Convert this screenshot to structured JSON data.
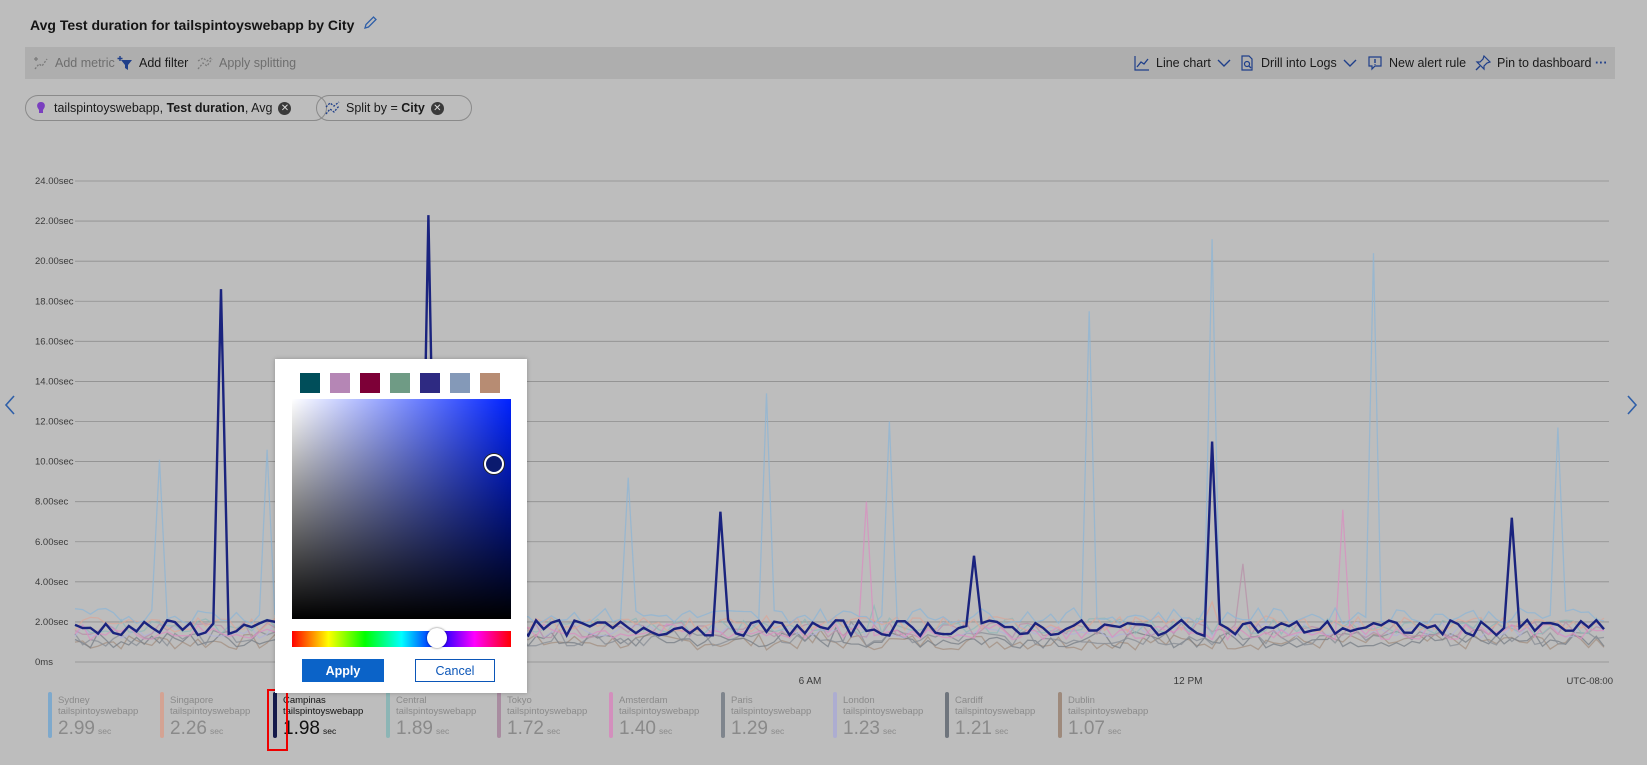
{
  "title": "Avg Test duration for tailspintoyswebapp by City",
  "toolbar": {
    "add_metric": "Add metric",
    "add_filter": "Add filter",
    "apply_splitting": "Apply splitting",
    "line_chart": "Line chart",
    "drill_into_logs": "Drill into Logs",
    "new_alert_rule": "New alert rule",
    "pin_to_dashboard": "Pin to dashboard",
    "more": "···"
  },
  "pills": {
    "metric_prefix": "tailspintoyswebapp, ",
    "metric_bold": "Test duration",
    "metric_suffix": ", Avg",
    "split_prefix": "Split by = ",
    "split_bold": "City"
  },
  "chart_data": {
    "type": "line",
    "y_ticks": [
      "0ms",
      "2.00sec",
      "4.00sec",
      "6.00sec",
      "8.00sec",
      "10.00sec",
      "12.00sec",
      "14.00sec",
      "16.00sec",
      "18.00sec",
      "20.00sec",
      "22.00sec",
      "24.00sec"
    ],
    "ylim": [
      0,
      24
    ],
    "y_unit": "sec",
    "x_ticks": [
      "6 AM",
      "12 PM"
    ],
    "timezone": "UTC-08:00",
    "grid": true,
    "highlighted_series": "Campinas",
    "series": [
      {
        "name": "Sydney",
        "color": "#8db5d6",
        "peaks": [
          10.1,
          10.6,
          7.2,
          9.2,
          13.4,
          12.0,
          17.5,
          21.1,
          20.4,
          11.7
        ]
      },
      {
        "name": "Singapore",
        "color": "#d9a79a",
        "peaks": [
          4.6,
          3.0
        ]
      },
      {
        "name": "Campinas",
        "color": "#1a237e",
        "peaks": [
          18.6,
          22.3,
          7.5,
          5.3,
          11.0,
          7.2
        ]
      },
      {
        "name": "Central",
        "color": "#8fb8b8",
        "peaks": [
          2.8
        ]
      },
      {
        "name": "Tokyo",
        "color": "#b890a8",
        "peaks": [
          5.2,
          4.9
        ]
      },
      {
        "name": "Amsterdam",
        "color": "#d98fc0",
        "peaks": [
          9.3,
          8.0,
          7.6
        ]
      },
      {
        "name": "Paris",
        "color": "#888e96",
        "peaks": [
          2.0
        ]
      },
      {
        "name": "London",
        "color": "#b2b2d8",
        "peaks": [
          1.9
        ]
      },
      {
        "name": "Cardiff",
        "color": "#777d85",
        "peaks": [
          1.7
        ]
      },
      {
        "name": "Dublin",
        "color": "#a38f80",
        "peaks": [
          1.6
        ]
      }
    ]
  },
  "legend": [
    {
      "city": "Sydney",
      "app": "tailspintoyswebapp",
      "value": "2.99",
      "unit": "sec",
      "color": "#7ea9cc"
    },
    {
      "city": "Singapore",
      "app": "tailspintoyswebapp",
      "value": "2.26",
      "unit": "sec",
      "color": "#d4a393"
    },
    {
      "city": "Campinas",
      "app": "tailspintoyswebapp",
      "value": "1.98",
      "unit": "sec",
      "color": "#141a4a"
    },
    {
      "city": "Central",
      "app": "tailspintoyswebapp",
      "value": "1.89",
      "unit": "sec",
      "color": "#8cb5b5"
    },
    {
      "city": "Tokyo",
      "app": "tailspintoyswebapp",
      "value": "1.72",
      "unit": "sec",
      "color": "#a88ca0"
    },
    {
      "city": "Amsterdam",
      "app": "tailspintoyswebapp",
      "value": "1.40",
      "unit": "sec",
      "color": "#d38fbd"
    },
    {
      "city": "Paris",
      "app": "tailspintoyswebapp",
      "value": "1.29",
      "unit": "sec",
      "color": "#7f858d"
    },
    {
      "city": "London",
      "app": "tailspintoyswebapp",
      "value": "1.23",
      "unit": "sec",
      "color": "#adadd1"
    },
    {
      "city": "Cardiff",
      "app": "tailspintoyswebapp",
      "value": "1.21",
      "unit": "sec",
      "color": "#6f757d"
    },
    {
      "city": "Dublin",
      "app": "tailspintoyswebapp",
      "value": "1.07",
      "unit": "sec",
      "color": "#9e8a7c"
    }
  ],
  "color_picker": {
    "swatches": [
      "#004e5a",
      "#b586b5",
      "#7d0037",
      "#6f9b85",
      "#2e2a82",
      "#8499b8",
      "#b78c73"
    ],
    "selected_color": "#0b1a6e",
    "hue_position": 0.66,
    "apply_label": "Apply",
    "cancel_label": "Cancel"
  }
}
